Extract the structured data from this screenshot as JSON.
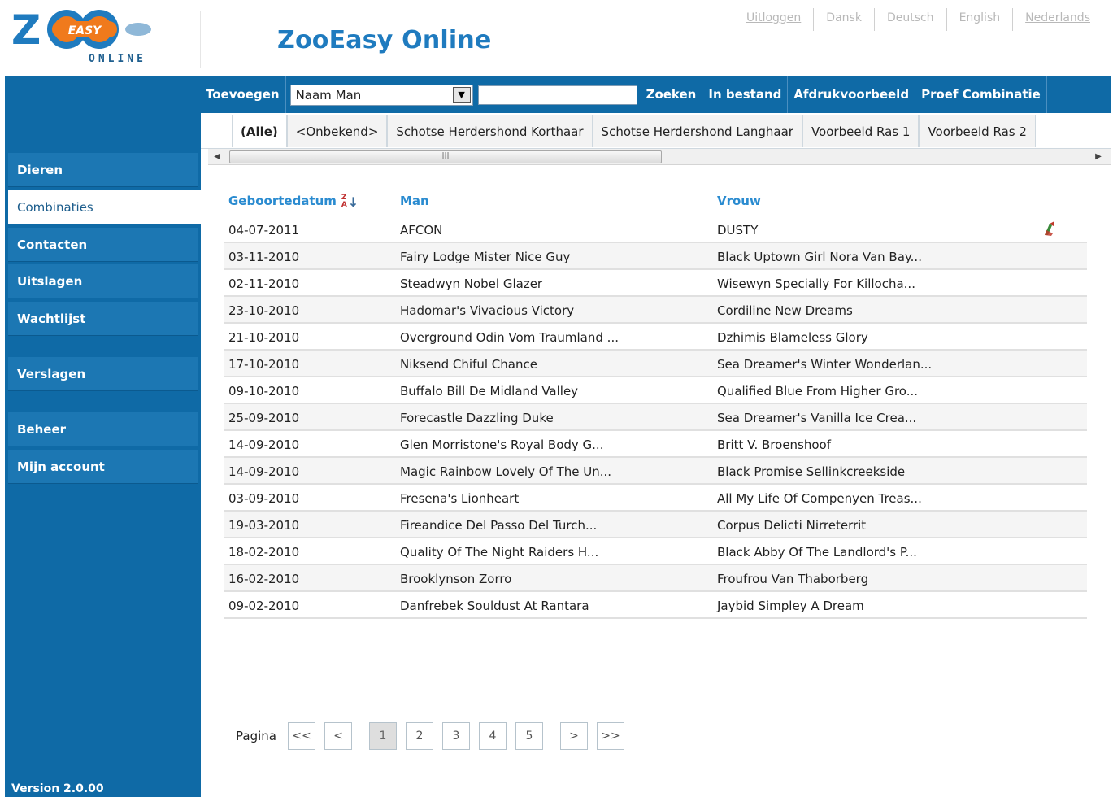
{
  "header": {
    "app_title": "ZooEasy Online",
    "logo_word": "EASY",
    "logo_sub": "ONLINE"
  },
  "lang": {
    "items": [
      "Uitloggen",
      "Dansk",
      "Deutsch",
      "English",
      "Nederlands"
    ]
  },
  "sidebar": {
    "items": [
      "Dieren",
      "Combinaties",
      "Contacten",
      "Uitslagen",
      "Wachtlijst",
      "Verslagen",
      "Beheer",
      "Mijn account"
    ],
    "active": "Combinaties",
    "version": "Version 2.0.00"
  },
  "toolbar": {
    "add_label": "Toevoegen",
    "select_value": "Naam Man",
    "search_value": "",
    "search_label": "Zoeken",
    "file_label": "In bestand",
    "print_label": "Afdrukvoorbeeld",
    "test_label": "Proef Combinatie"
  },
  "tabs": [
    "(Alle)",
    "<Onbekend>",
    "Schotse Herdershond Korthaar",
    "Schotse Herdershond Langhaar",
    "Voorbeeld Ras 1",
    "Voorbeeld Ras 2"
  ],
  "table": {
    "headers": {
      "date": "Geboortedatum",
      "man": "Man",
      "vrouw": "Vrouw"
    },
    "rows": [
      {
        "date": "04-07-2011",
        "man": "AFCON",
        "vrouw": "DUSTY"
      },
      {
        "date": "03-11-2010",
        "man": "Fairy Lodge Mister Nice Guy",
        "vrouw": "Black Uptown Girl Nora Van Bay..."
      },
      {
        "date": "02-11-2010",
        "man": "Steadwyn Nobel Glazer",
        "vrouw": "Wisewyn Specially For Killocha..."
      },
      {
        "date": "23-10-2010",
        "man": "Hadomar's Vivacious Victory",
        "vrouw": "Cordiline New Dreams"
      },
      {
        "date": "21-10-2010",
        "man": "Overground Odin Vom Traumland ...",
        "vrouw": "Dzhimis Blameless Glory"
      },
      {
        "date": "17-10-2010",
        "man": "Niksend Chiful Chance",
        "vrouw": "Sea Dreamer's Winter Wonderlan..."
      },
      {
        "date": "09-10-2010",
        "man": "Buffalo Bill De Midland Valley",
        "vrouw": "Qualified Blue From Higher Gro..."
      },
      {
        "date": "25-09-2010",
        "man": "Forecastle Dazzling Duke",
        "vrouw": "Sea Dreamer's Vanilla Ice Crea..."
      },
      {
        "date": "14-09-2010",
        "man": "Glen Morristone's Royal Body G...",
        "vrouw": "Britt V. Broenshoof"
      },
      {
        "date": "14-09-2010",
        "man": "Magic Rainbow Lovely Of The Un...",
        "vrouw": "Black Promise Sellinkcreekside"
      },
      {
        "date": "03-09-2010",
        "man": "Fresena's Lionheart",
        "vrouw": "All My Life Of Compenyen Treas..."
      },
      {
        "date": "19-03-2010",
        "man": "Fireandice Del Passo Del Turch...",
        "vrouw": "Corpus Delicti Nirreterrit"
      },
      {
        "date": "18-02-2010",
        "man": "Quality Of The Night Raiders H...",
        "vrouw": "Black Abby Of The Landlord's P..."
      },
      {
        "date": "16-02-2010",
        "man": "Brooklynson Zorro",
        "vrouw": "Froufrou Van Thaborberg"
      },
      {
        "date": "09-02-2010",
        "man": "Danfrebek Souldust At Rantara",
        "vrouw": "Jaybid Simpley A Dream"
      }
    ]
  },
  "pager": {
    "label": "Pagina",
    "first": "<<",
    "prev": "<",
    "pages": [
      "1",
      "2",
      "3",
      "4",
      "5"
    ],
    "current": "1",
    "next": ">",
    "last": ">>"
  },
  "colors": {
    "brand_blue": "#0f6aa6",
    "title_blue": "#1f7bbf",
    "logo_orange": "#f07a1c"
  }
}
